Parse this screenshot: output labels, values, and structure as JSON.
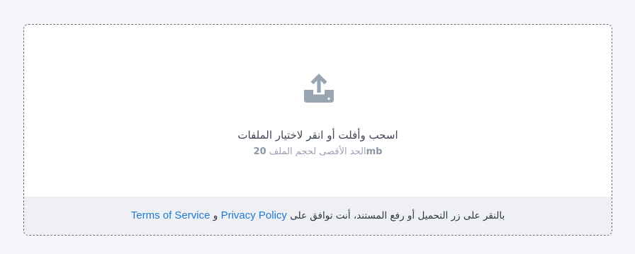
{
  "colors": {
    "page_background": "#f5f6f9",
    "card_background": "#ffffff",
    "footer_background": "#eef0f3",
    "icon": "#9aa5b3",
    "link": "#1f7ad6"
  },
  "dropzone": {
    "icon": "upload-tray-arrow-icon",
    "primary_text": "اسحب وأفلت أو انقر لاختيار الملفات",
    "max_size_label": "الحد الأقصى لحجم الملف",
    "max_size_value": "20",
    "max_size_unit": "mb"
  },
  "footer": {
    "prefix": "بالنقر على زر التحميل أو رفع المستند، أنت توافق على",
    "terms_link": "Terms of Service",
    "conjunction": "و",
    "privacy_link": "Privacy Policy"
  }
}
